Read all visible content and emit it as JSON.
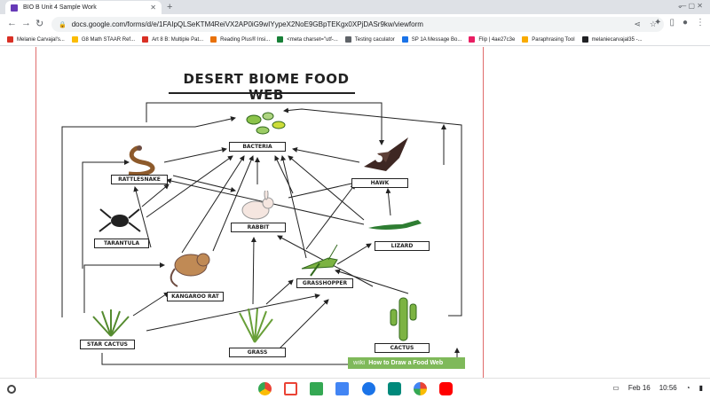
{
  "browser": {
    "tab_title": "BIO B Unit 4 Sample Work",
    "tab_close": "✕",
    "url": "docs.google.com/forms/d/e/1FAIpQLSeKTM4ReiVX2AP0iG9wIYypeX2NoE9GBpTEKgx0XPjDASr9kw/viewform",
    "bookmarks": [
      {
        "label": "Melanie Carvajal's...",
        "color": "#d93025"
      },
      {
        "label": "G8 Math STAAR Ref...",
        "color": "#fbbc04"
      },
      {
        "label": "Art 8 B: Multiple Pat...",
        "color": "#d93025"
      },
      {
        "label": "Reading Plus® Insi...",
        "color": "#e8710a"
      },
      {
        "label": "<meta charset=\"utf-...",
        "color": "#188038"
      },
      {
        "label": "Testing caculator",
        "color": "#5f6368"
      },
      {
        "label": "SP 1A Message Bo...",
        "color": "#1a73e8"
      },
      {
        "label": "Flip | 4ae27c3e",
        "color": "#e91e63"
      },
      {
        "label": "Paraphrasing Tool",
        "color": "#f9ab00"
      },
      {
        "label": "melaniecarvajal35 -...",
        "color": "#202124"
      }
    ]
  },
  "diagram": {
    "title": "DESERT BIOME FOOD WEB",
    "labels": {
      "bacteria": "BACTERIA",
      "hawk": "HAWK",
      "rattlesnake": "RATTLESNAKE",
      "rabbit": "RABBIT",
      "tarantula": "TARANTULA",
      "lizard": "LIZARD",
      "kangaroo_rat": "KANGAROO RAT",
      "grasshopper": "GRASSHOPPER",
      "star_cactus": "STAR CACTUS",
      "grass": "GRASS",
      "cactus": "CACTUS"
    },
    "watermark_brand": "wiki",
    "watermark_text": "How to Draw a Food Web"
  },
  "shelf": {
    "date": "Feb 16",
    "time": "10:56"
  }
}
